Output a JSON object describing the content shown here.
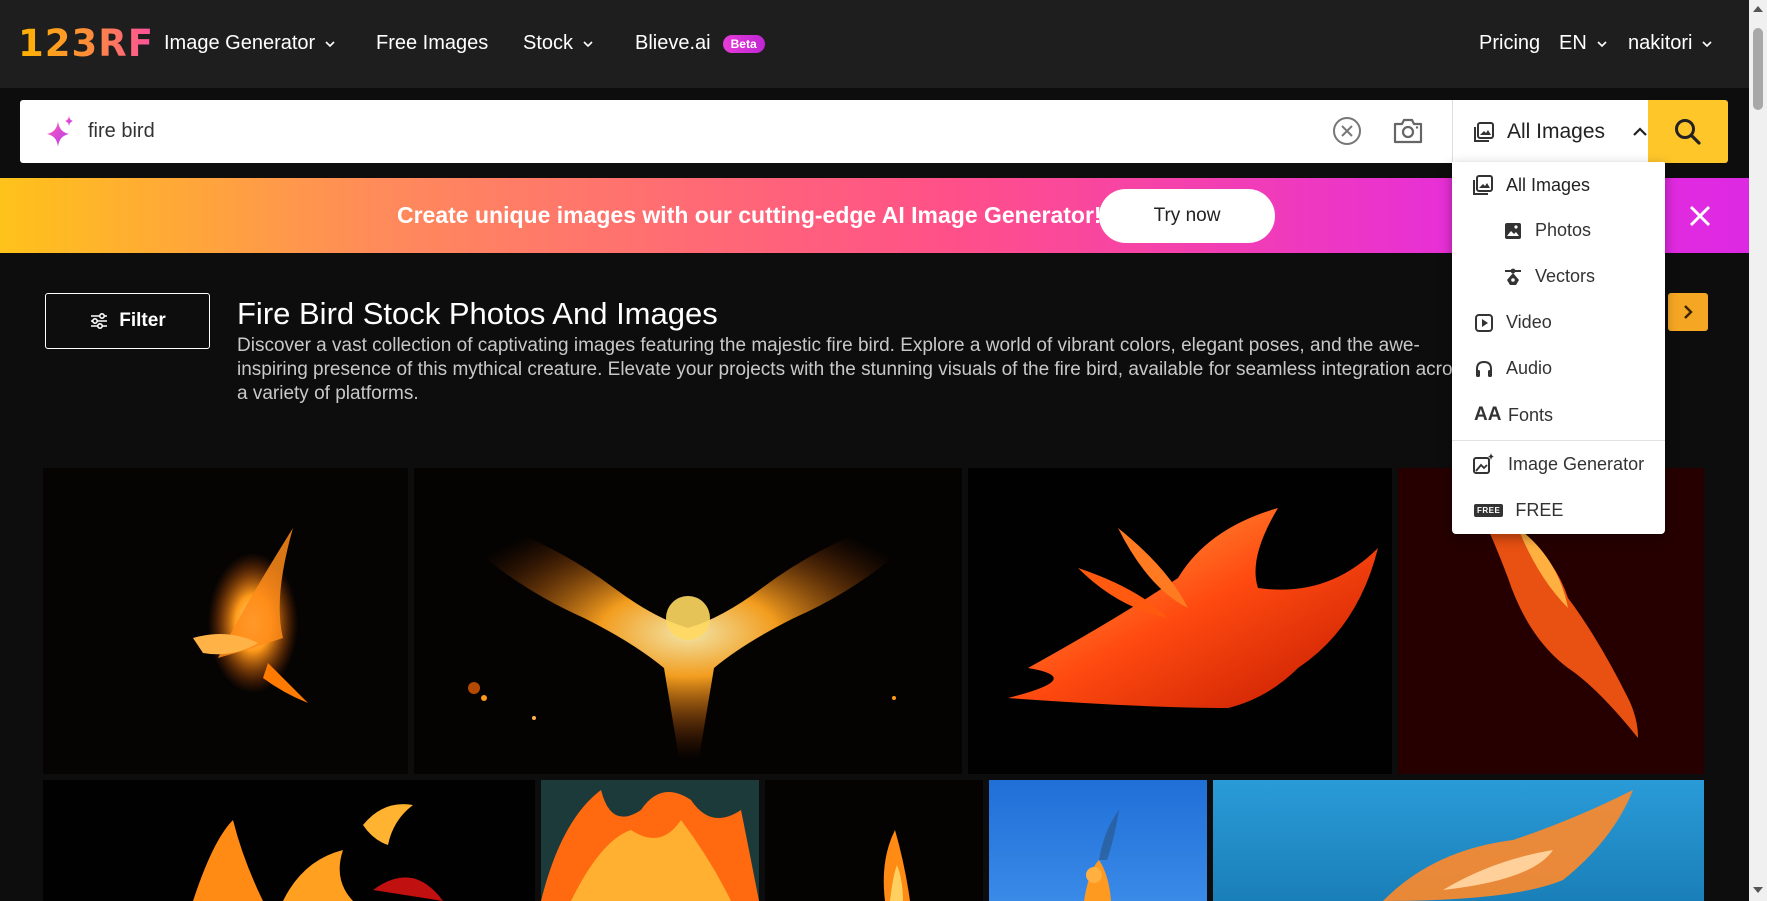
{
  "brand": {
    "logo": "123RF"
  },
  "nav": {
    "image_generator": "Image Generator",
    "free_images": "Free Images",
    "stock": "Stock",
    "blieve": "Blieve.ai",
    "beta_badge": "Beta",
    "pricing": "Pricing",
    "language": "EN",
    "user": "nakitori"
  },
  "search": {
    "query": "fire bird",
    "type_selected": "All Images"
  },
  "banner": {
    "text": "Create unique images with our cutting-edge AI Image Generator!",
    "cta": "Try now"
  },
  "header": {
    "filter_label": "Filter",
    "title": "Fire Bird Stock Photos And Images",
    "description": "Discover a vast collection of captivating images featuring the majestic fire bird. Explore a world of vibrant colors, elegant poses, and the awe-inspiring presence of this mythical creature. Elevate your projects with the stunning visuals of the fire bird, available for seamless integration across a variety of platforms."
  },
  "dropdown": {
    "all_images": "All Images",
    "photos": "Photos",
    "vectors": "Vectors",
    "video": "Video",
    "audio": "Audio",
    "fonts": "Fonts",
    "image_generator": "Image Generator",
    "free": "FREE",
    "free_tag": "FREE",
    "fonts_icon_text": "AA"
  },
  "colors": {
    "accent_yellow": "#ffc62a",
    "banner_start": "#ffc21a",
    "banner_end": "#de29e2",
    "beta_pink": "#e63cd8"
  },
  "icons": [
    "sparkle-icon",
    "clear-icon",
    "camera-icon",
    "image-type-icon",
    "chevron-up-icon",
    "search-icon",
    "close-icon",
    "filter-sliders-icon",
    "chevron-right-icon",
    "photo-icon",
    "vector-pen-icon",
    "video-play-icon",
    "headphones-icon",
    "fonts-icon",
    "ai-image-icon",
    "free-badge-icon"
  ]
}
